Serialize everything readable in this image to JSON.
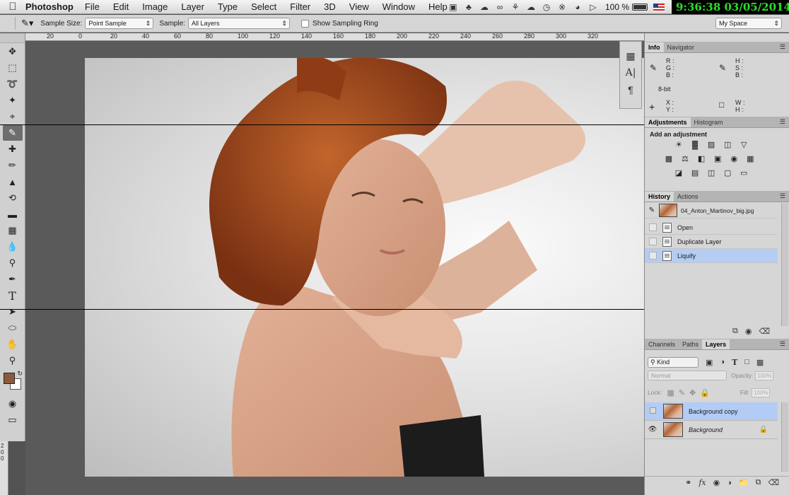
{
  "menubar": {
    "app_name": "Photoshop",
    "items": [
      "File",
      "Edit",
      "Image",
      "Layer",
      "Type",
      "Select",
      "Filter",
      "3D",
      "View",
      "Window",
      "Help"
    ],
    "battery_percent": "100 %",
    "clock": "9:36:38  03/05/2014",
    "status_icons": [
      "monitor-icon",
      "evernote-icon",
      "cloud-icon",
      "creative-cloud-icon",
      "handshake-icon",
      "cloud-sync-icon",
      "time-machine-icon",
      "bluetooth-icon",
      "wifi-icon",
      "volume-icon"
    ]
  },
  "options": {
    "sample_size_label": "Sample Size:",
    "sample_size_value": "Point Sample",
    "sample_label": "Sample:",
    "sample_value": "All Layers",
    "show_ring_label": "Show Sampling Ring",
    "workspace_value": "My Space"
  },
  "ruler": {
    "top_ticks": [
      "20",
      "0",
      "20",
      "40",
      "60",
      "80",
      "100",
      "120",
      "140",
      "160",
      "180",
      "200",
      "220",
      "240",
      "260",
      "280",
      "300",
      "320"
    ],
    "left_ticks": [
      "2",
      "0",
      "0"
    ]
  },
  "tools": [
    "move-tool-icon",
    "marquee-tool-icon",
    "lasso-tool-icon",
    "quick-select-tool-icon",
    "crop-tool-icon",
    "eyedropper-tool-icon",
    "healing-brush-tool-icon",
    "brush-tool-icon",
    "clone-stamp-tool-icon",
    "history-brush-tool-icon",
    "eraser-tool-icon",
    "gradient-tool-icon",
    "blur-tool-icon",
    "dodge-tool-icon",
    "pen-tool-icon",
    "type-tool-icon",
    "path-select-tool-icon",
    "ellipse-tool-icon",
    "hand-tool-icon",
    "zoom-tool-icon"
  ],
  "colors": {
    "foreground": "#8b5a3c",
    "background": "#ffffff",
    "selected_row": "#b5cdf3",
    "panel_bg": "#d6d6d6"
  },
  "info_panel": {
    "tabs": [
      "Info",
      "Navigator"
    ],
    "r": "R :",
    "g": "G :",
    "b": "B :",
    "h": "H :",
    "s": "S :",
    "b2": "B :",
    "bit_depth": "8-bit",
    "x": "X :",
    "y": "Y :",
    "w": "W :",
    "h2": "H :"
  },
  "adjustments_panel": {
    "tabs": [
      "Adjustments",
      "Histogram"
    ],
    "heading": "Add an adjustment"
  },
  "history_panel": {
    "tabs": [
      "History",
      "Actions"
    ],
    "snapshot_name": "04_Anton_Martinov_big.jpg",
    "states": [
      "Open",
      "Duplicate Layer",
      "Liquify"
    ],
    "selected_index": 2
  },
  "layers_panel": {
    "tabs": [
      "Channels",
      "Paths",
      "Layers"
    ],
    "filter_value": "Kind",
    "blend_mode": "Normal",
    "opacity_label": "Opacity:",
    "opacity_value": "100%",
    "lock_label": "Lock:",
    "fill_label": "Fill:",
    "fill_value": "100%",
    "layers": [
      {
        "name": "Background copy",
        "visible": false,
        "selected": true,
        "locked": false
      },
      {
        "name": "Background",
        "visible": true,
        "selected": false,
        "locked": true
      }
    ]
  }
}
